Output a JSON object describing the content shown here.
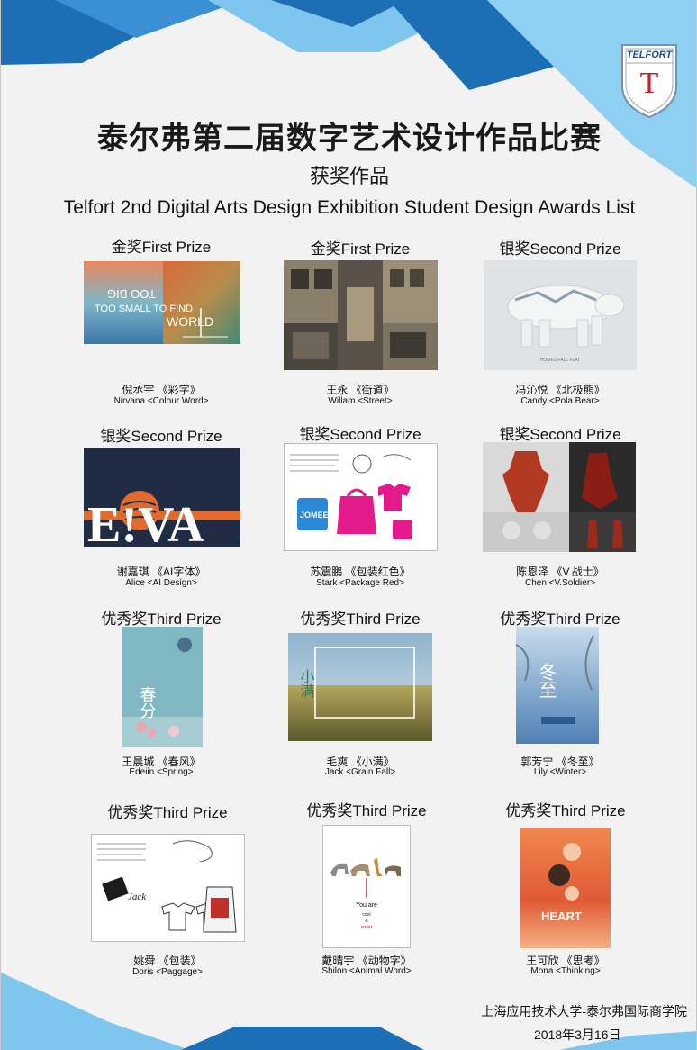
{
  "header": {
    "title_cn": "泰尔弗第二届数字艺术设计作品比赛",
    "subtitle_cn": "获奖作品",
    "subtitle_en": "Telfort 2nd Digital Arts Design Exhibition Student Design Awards List"
  },
  "logo": {
    "text": "TELFORT",
    "letter": "T",
    "icon": "telfort-shield-logo"
  },
  "colors": {
    "accent_dark": "#1c6fb5",
    "accent_light": "#7fc6ee",
    "logo_red": "#c8202a"
  },
  "awards": [
    {
      "prize": "金奖First Prize",
      "author": "倪丞宇 《彩字》",
      "work": "Nirvana <Colour Word>"
    },
    {
      "prize": "金奖First Prize",
      "author": "王永 《街道》",
      "work": "Willam <Street>"
    },
    {
      "prize": "银奖Second Prize",
      "author": "冯沁悦 《北极熊》",
      "work": "Candy <Pola Bear>"
    },
    {
      "prize": "银奖Second Prize",
      "author": "谢嘉琪 《AI字体》",
      "work": "Alice <AI Design>"
    },
    {
      "prize": "银奖Second Prize",
      "author": "苏震鹏 《包装红色》",
      "work": "Stark <Package Red>"
    },
    {
      "prize": "银奖Second Prize",
      "author": "陈恩泽 《V.战士》",
      "work": "Chen <V.Soldier>"
    },
    {
      "prize": "优秀奖Third Prize",
      "author": "王晨城 《春风》",
      "work": "Edeiin <Spring>"
    },
    {
      "prize": "优秀奖Third Prize",
      "author": "毛爽 《小满》",
      "work": "Jack <Grain Fall>"
    },
    {
      "prize": "优秀奖Third Prize",
      "author": "郭芳宁 《冬至》",
      "work": "Lily <Winter>"
    },
    {
      "prize": "优秀奖Third Prize",
      "author": "姚舜 《包装》",
      "work": "Doris <Paggage>"
    },
    {
      "prize": "优秀奖Third Prize",
      "author": "戴晴宇 《动物字》",
      "work": "Shilon <Animal Word>"
    },
    {
      "prize": "优秀奖Third Prize",
      "author": "王可欣 《思考》",
      "work": "Mona <Thinking>"
    }
  ],
  "artwork_text": {
    "colour_word": [
      "TOO SMALL TO FIND",
      "TOO BIG",
      "WORLD"
    ],
    "ai_design": "E!VA",
    "package_brand": "JOMEES",
    "spring_char": "春分",
    "grain_char": "小满",
    "winter_char": "冬至",
    "animal_word": [
      "You are",
      "cool",
      "&",
      "smart"
    ],
    "thinking_word": "HEART",
    "pola_bear_caption": "HOMES FALL FLAT",
    "package_jack": "Jack"
  },
  "footer": {
    "org": "上海应用技术大学-泰尔弗国际商学院",
    "date": "2018年3月16日"
  }
}
